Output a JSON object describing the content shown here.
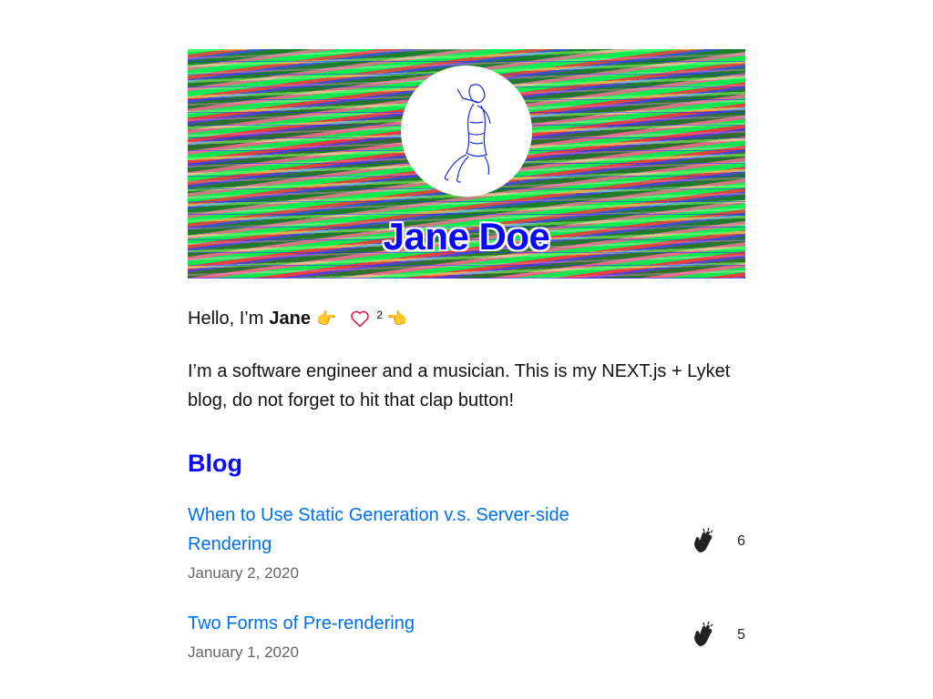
{
  "header": {
    "name": "Jane Doe"
  },
  "intro": {
    "greeting": "Hello, I’m",
    "name": "Jane",
    "pointer_right": "👉",
    "like_count": "2",
    "pointer_left": "👈"
  },
  "bio": "I’m a software engineer and a musician. This is my NEXT.js + Lyket blog, do not forget to hit that clap button!",
  "blog": {
    "heading": "Blog",
    "posts": [
      {
        "title": "When to Use Static Generation v.s. Server-side Rendering",
        "date": "January 2, 2020",
        "claps": "6"
      },
      {
        "title": "Two Forms of Pre-rendering",
        "date": "January 1, 2020",
        "claps": "5"
      }
    ]
  },
  "colors": {
    "accent": "#0a0af5",
    "link": "#0070f3",
    "heart": "#e0244a",
    "date": "#666666"
  },
  "icons": {
    "heart": "heart-icon",
    "clap": "clap-icon",
    "avatar": "avatar-illustration"
  }
}
